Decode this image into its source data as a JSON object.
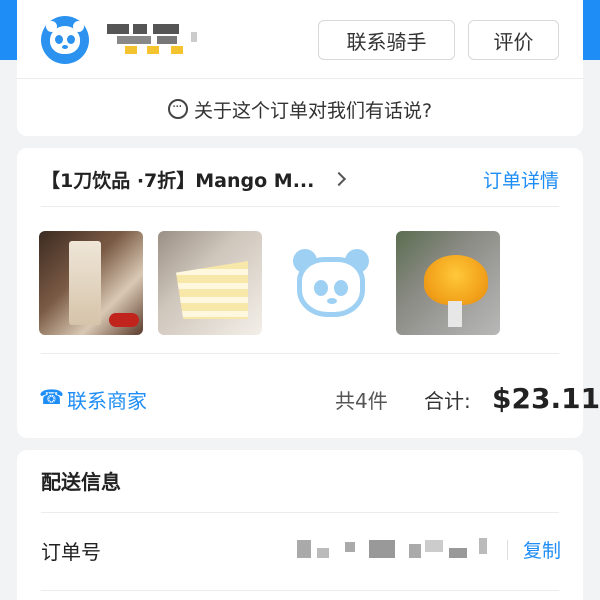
{
  "colors": {
    "accent": "#1e8df5",
    "header_blue": "#1e8df5",
    "background": "#f2f3f5"
  },
  "rider_card": {
    "contact_rider_label": "联系骑手",
    "review_label": "评价",
    "feedback_text": "关于这个订单对我们有话说?"
  },
  "order_card": {
    "shop_name": "【1刀饮品 ·7折】Mango M...",
    "order_details_label": "订单详情",
    "items": [
      {
        "icon": "milk-tea-photo"
      },
      {
        "icon": "crepe-cake-photo"
      },
      {
        "icon": "panda-placeholder-icon"
      },
      {
        "icon": "mango-dessert-photo"
      }
    ],
    "contact_merchant_label": "联系商家",
    "item_count": "共4件",
    "total_label": "合计:",
    "total_value": "$23.11"
  },
  "delivery_card": {
    "title": "配送信息",
    "order_number_label": "订单号",
    "copy_label": "复制"
  }
}
